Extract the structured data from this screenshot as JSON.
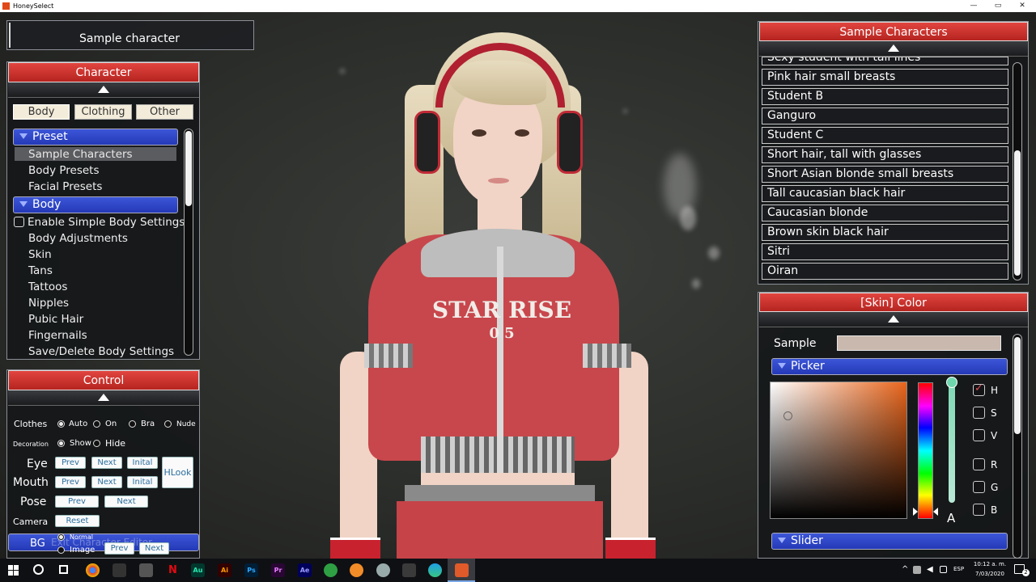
{
  "window": {
    "title": "HoneySelect",
    "controls": [
      "—",
      "▭",
      "✕"
    ]
  },
  "top_label": "Sample character",
  "character_panel": {
    "title": "Character",
    "tabs": [
      "Body",
      "Clothing",
      "Other"
    ],
    "groups": [
      {
        "label": "Preset",
        "items": [
          "Sample Characters",
          "Body Presets",
          "Facial Presets"
        ]
      },
      {
        "label": "Body",
        "checkbox_item": "Enable Simple Body Settings",
        "items": [
          "Body Adjustments",
          "Skin",
          "Tans",
          "Tattoos",
          "Nipples",
          "Pubic Hair",
          "Fingernails",
          "Save/Delete Body Settings"
        ]
      }
    ],
    "selected_item": "Sample Characters"
  },
  "control_panel": {
    "title": "Control",
    "clothes": {
      "label": "Clothes",
      "options": [
        "Auto",
        "On",
        "Bra",
        "Nude"
      ],
      "selected": "Auto"
    },
    "decoration": {
      "label": "Decoration",
      "options": [
        "Show",
        "Hide"
      ],
      "selected": "Show"
    },
    "eye": {
      "label": "Eye",
      "buttons": [
        "Prev",
        "Next",
        "Inital"
      ]
    },
    "mouth": {
      "label": "Mouth",
      "buttons": [
        "Prev",
        "Next",
        "Inital"
      ]
    },
    "hlook": "HLook",
    "pose": {
      "label": "Pose",
      "buttons": [
        "Prev",
        "Next"
      ]
    },
    "camera": {
      "label": "Camera",
      "button": "Reset"
    },
    "bg": {
      "label": "BG",
      "options": [
        "Normal",
        "Image"
      ],
      "buttons": [
        "Prev",
        "Next"
      ]
    },
    "overlay_text": "Exit Character Editor"
  },
  "sample_characters_panel": {
    "title": "Sample Characters",
    "partial_item": "Sexy student with tall lines",
    "items": [
      "Pink hair small breasts",
      "Student B",
      "Ganguro",
      "Student C",
      "Short hair, tall with glasses",
      "Short Asian blonde small breasts",
      "Tall caucasian black hair",
      "Caucasian blonde",
      "Brown skin black hair",
      "Sitri",
      "Oiran"
    ]
  },
  "skin_color_panel": {
    "title": "[Skin] Color",
    "sample_label": "Sample",
    "sample_color": "#c9b8ad",
    "picker_label": "Picker",
    "slider_label": "Slider",
    "alpha_label": "A",
    "channels": [
      {
        "label": "H",
        "checked": true
      },
      {
        "label": "S",
        "checked": false
      },
      {
        "label": "V",
        "checked": false
      },
      {
        "label": "R",
        "checked": false
      },
      {
        "label": "G",
        "checked": false
      },
      {
        "label": "B",
        "checked": false
      }
    ],
    "hue_color": "#e8651c"
  },
  "shirt_print": {
    "line1": "STAR RISE",
    "line2": "0 5"
  },
  "taskbar": {
    "apps": [
      "Ai",
      "Ps",
      "Pr",
      "Ae",
      "Au"
    ],
    "language": "ESP",
    "time": "10:12 a. m.",
    "date": "7/03/2020",
    "notification_count": "2"
  }
}
